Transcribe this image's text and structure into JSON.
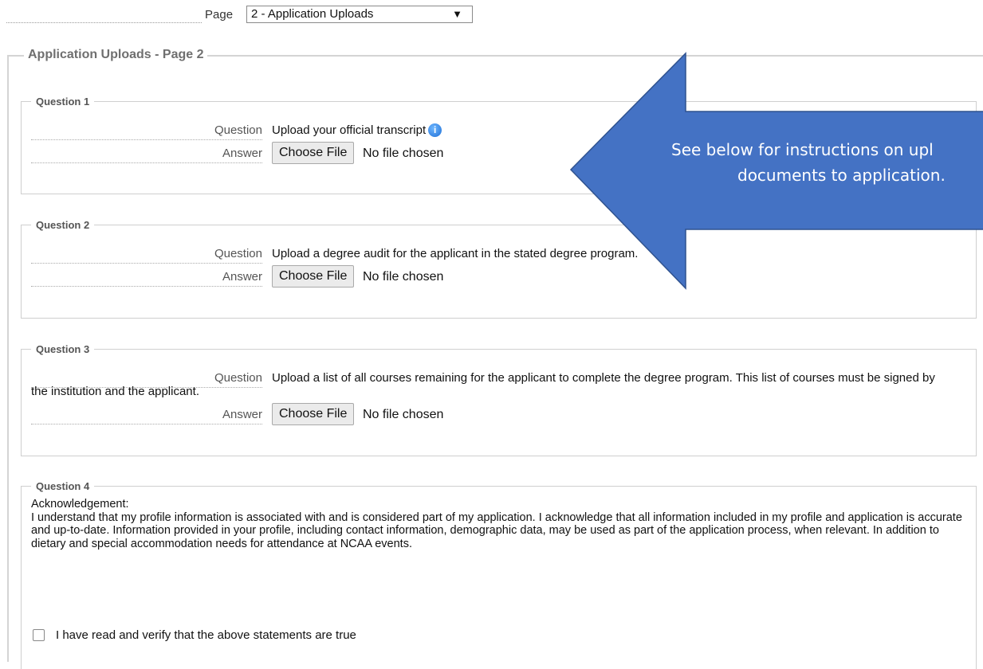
{
  "page_nav": {
    "label": "Page",
    "selected": "2 - Application Uploads"
  },
  "section": {
    "title": "Application Uploads - Page 2"
  },
  "questions": [
    {
      "legend": "Question 1",
      "question_label": "Question",
      "question_text": "Upload your official transcript",
      "answer_label": "Answer",
      "button": "Choose File",
      "status": "No file chosen"
    },
    {
      "legend": "Question 2",
      "question_label": "Question",
      "question_text": "Upload a degree audit for the applicant in the stated degree program.",
      "answer_label": "Answer",
      "button": "Choose File",
      "status": "No file chosen"
    },
    {
      "legend": "Question 3",
      "question_label": "Question",
      "question_text": "Upload a list of all courses remaining for the applicant to complete the degree program. This list of courses must be signed by",
      "question_text_cont": "the institution and the applicant.",
      "answer_label": "Answer",
      "button": "Choose File",
      "status": "No file chosen"
    },
    {
      "legend": "Question 4",
      "ack_title": "Acknowledgement:",
      "ack_text": "I understand that my profile information is associated with and is considered part of my application. I acknowledge that all information included in my profile and application is accurate and up-to-date. Information provided in your profile, including contact information, demographic data, may be used as part of the application process, when relevant. In addition to dietary and special accommodation needs for attendance at NCAA events.",
      "checkbox_label": "I have read and verify that the above statements are true"
    }
  ],
  "callout": {
    "line1": "See below for instructions on upl",
    "line2": "documents to application."
  },
  "colors": {
    "callout_fill": "#4472c4",
    "callout_stroke": "#2f528f",
    "info_icon": "#1f6fd6"
  }
}
